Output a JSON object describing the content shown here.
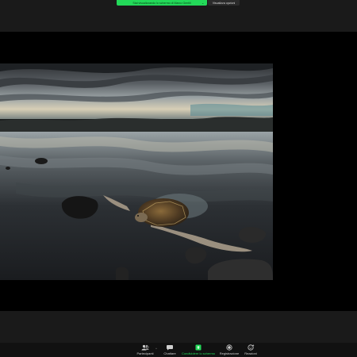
{
  "top_bar": {
    "share_banner": "Stai visualizzando lo schermo di Marco Gentili",
    "view_options": "Visualizza opzioni",
    "caret": "⌄"
  },
  "toolbar": {
    "participants_count": "142",
    "items": [
      {
        "label": "Partecipanti",
        "icon": "participants-icon"
      },
      {
        "label": "Chattare",
        "icon": "chat-icon"
      },
      {
        "label": "Condividere lo schermo",
        "icon": "share-screen-icon"
      },
      {
        "label": "Registrazione",
        "icon": "record-icon"
      },
      {
        "label": "Reazioni",
        "icon": "reactions-icon"
      }
    ],
    "caret": "^"
  },
  "colors": {
    "accent_green": "#23d959",
    "bar_dark": "#1a1a1a",
    "toolbar_bg": "#111111"
  }
}
